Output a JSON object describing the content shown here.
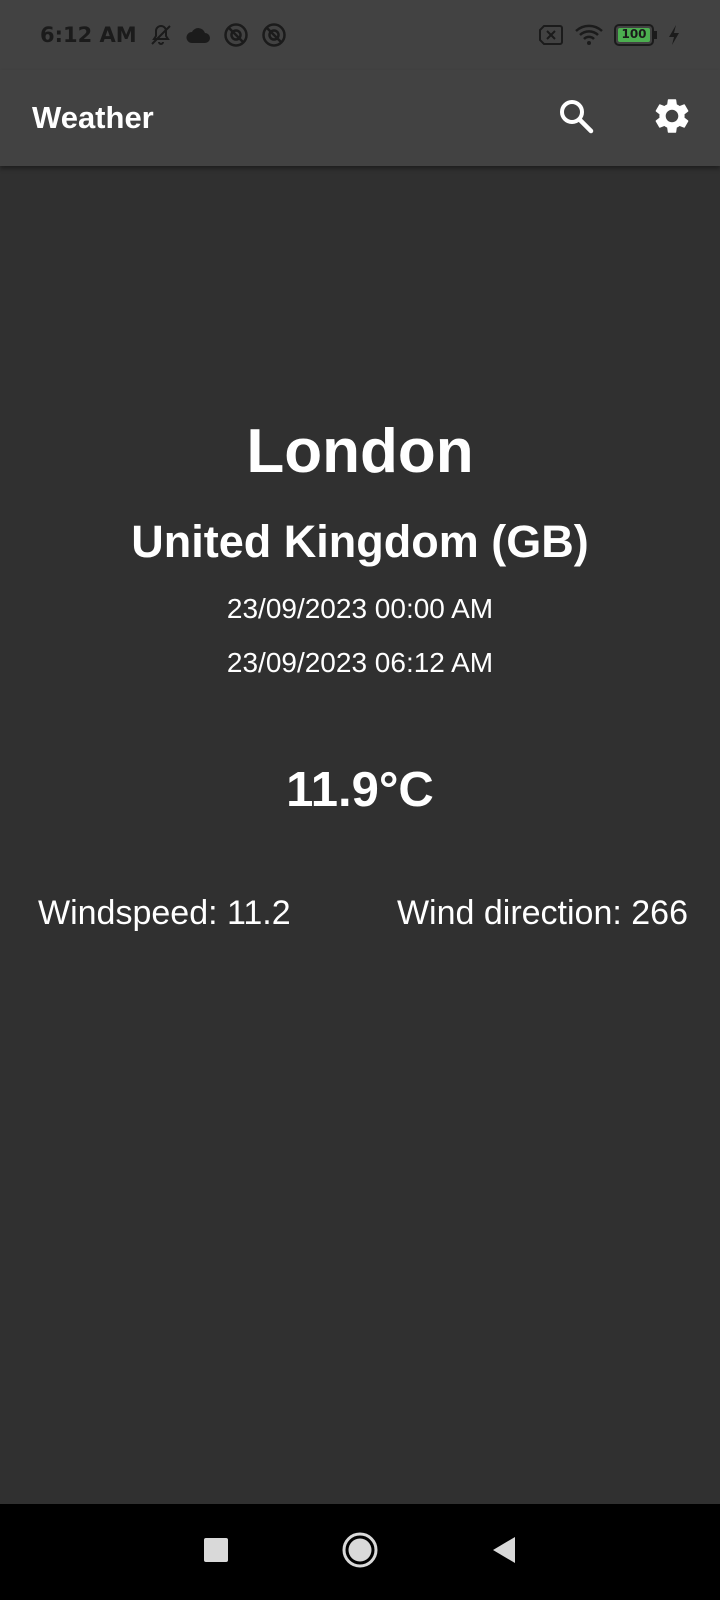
{
  "status_bar": {
    "time": "6:12 AM",
    "left_icons": [
      "notifications-off-icon",
      "cloud-icon",
      "app-notification-icon",
      "app-notification-icon"
    ],
    "right_icons": [
      "sim-x-icon",
      "wifi-icon",
      "battery-icon",
      "charging-bolt-icon"
    ],
    "battery_level": "100",
    "battery_color": "#4caf50"
  },
  "app_bar": {
    "title": "Weather",
    "actions": [
      "search-icon",
      "settings-gear-icon"
    ]
  },
  "weather": {
    "city": "London",
    "country": "United Kingdom (GB)",
    "date_1": "23/09/2023 00:00 AM",
    "date_2": "23/09/2023 06:12 AM",
    "temperature": "11.9°C",
    "windspeed": "Windspeed: 11.2",
    "wind_direction": "Wind direction: 266"
  },
  "nav_bar": {
    "buttons": [
      "recents-square-icon",
      "home-circle-icon",
      "back-triangle-icon"
    ]
  },
  "colors": {
    "background": "#303030",
    "app_bar": "#424242",
    "text": "#ffffff",
    "nav_bar": "#000000"
  }
}
